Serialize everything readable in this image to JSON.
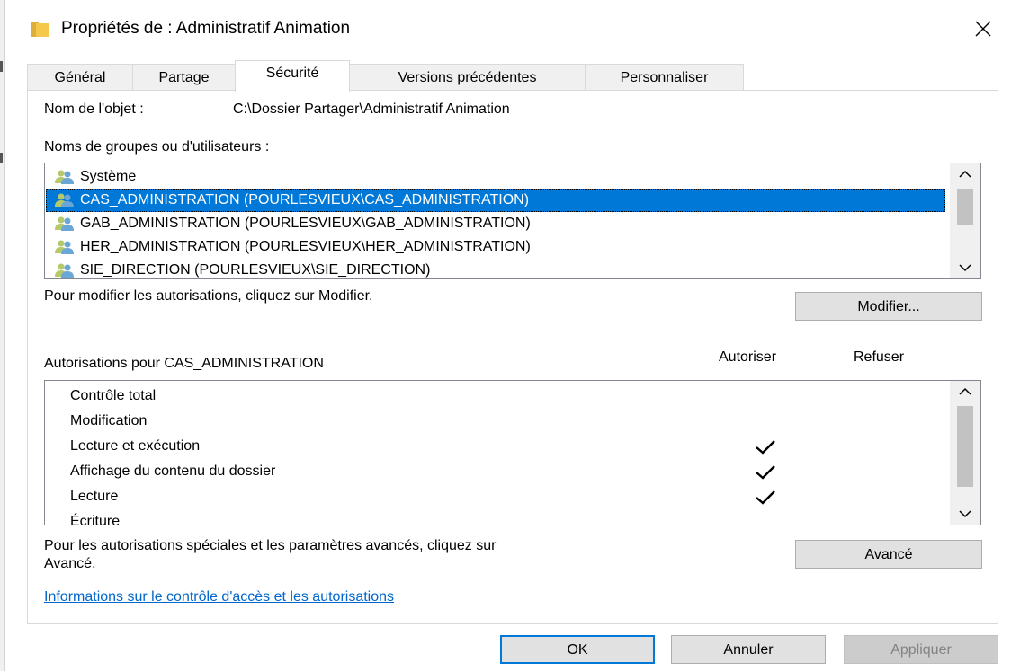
{
  "window": {
    "title": "Propriétés de : Administratif Animation",
    "close_label": "✕"
  },
  "tabs": [
    {
      "label": "Général",
      "active": false
    },
    {
      "label": "Partage",
      "active": false
    },
    {
      "label": "Sécurité",
      "active": true
    },
    {
      "label": "Versions précédentes",
      "active": false
    },
    {
      "label": "Personnaliser",
      "active": false
    }
  ],
  "object": {
    "label": "Nom de l'objet :",
    "value": "C:\\Dossier Partager\\Administratif Animation"
  },
  "groups": {
    "label": "Noms de groupes ou d'utilisateurs :",
    "items": [
      {
        "label": "Système",
        "selected": false
      },
      {
        "label": "CAS_ADMINISTRATION (POURLESVIEUX\\CAS_ADMINISTRATION)",
        "selected": true
      },
      {
        "label": "GAB_ADMINISTRATION (POURLESVIEUX\\GAB_ADMINISTRATION)",
        "selected": false
      },
      {
        "label": "HER_ADMINISTRATION (POURLESVIEUX\\HER_ADMINISTRATION)",
        "selected": false
      },
      {
        "label": "SIE_DIRECTION (POURLESVIEUX\\SIE_DIRECTION)",
        "selected": false
      }
    ]
  },
  "modify": {
    "hint": "Pour modifier les autorisations, cliquez sur Modifier.",
    "button": "Modifier..."
  },
  "permissions": {
    "label": "Autorisations pour CAS_ADMINISTRATION",
    "allow_header": "Autoriser",
    "deny_header": "Refuser",
    "items": [
      {
        "label": "Contrôle total",
        "allow": false,
        "deny": false
      },
      {
        "label": "Modification",
        "allow": false,
        "deny": false
      },
      {
        "label": "Lecture et exécution",
        "allow": true,
        "deny": false
      },
      {
        "label": "Affichage du contenu du dossier",
        "allow": true,
        "deny": false
      },
      {
        "label": "Lecture",
        "allow": true,
        "deny": false
      },
      {
        "label": "Écriture",
        "allow": false,
        "deny": false
      }
    ]
  },
  "advanced": {
    "hint_line1": "Pour les autorisations spéciales et les paramètres avancés, cliquez sur",
    "hint_line2": "Avancé.",
    "button": "Avancé"
  },
  "link": "Informations sur le contrôle d'accès et les autorisations",
  "footer": {
    "ok": "OK",
    "cancel": "Annuler",
    "apply": "Appliquer"
  },
  "colors": {
    "selection": "#0078d7",
    "link": "#0066cc",
    "folder": "#f5c84c"
  }
}
